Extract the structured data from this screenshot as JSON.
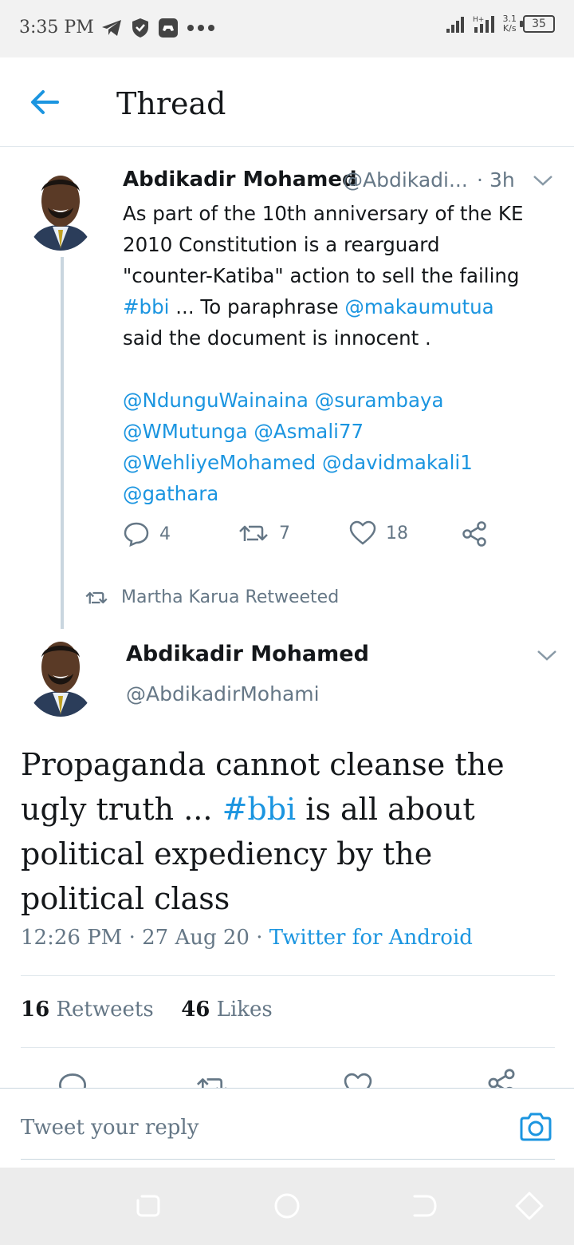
{
  "status_bar": {
    "time": "3:35 PM",
    "speed_value": "3.1",
    "speed_unit": "K/s",
    "battery": "35"
  },
  "header": {
    "title": "Thread"
  },
  "tweet1": {
    "name": "Abdikadir Mohamed",
    "handle": "@Abdikadi...",
    "dot": "·",
    "time": "3h",
    "line1": "As part of the 10th anniversary of the KE",
    "line2": "2010 Constitution is a rearguard",
    "line3": "\"counter-Katiba\" action  to sell the failing",
    "hashtag": "#bbi",
    "line4_mid": " ... To paraphrase ",
    "mention_main": "@makaumutua",
    "line5": "said the document is innocent .",
    "mentions": [
      "@NdunguWainaina",
      "@surambaya",
      "@WMutunga",
      "@Asmali77",
      "@WehliyeMohamed",
      "@davidmakali1",
      "@gathara"
    ],
    "reply_count": "4",
    "retweet_count": "7",
    "like_count": "18"
  },
  "retweeted_by": "Martha Karua Retweeted",
  "tweet2": {
    "name": "Abdikadir Mohamed",
    "handle": "@AbdikadirMohami",
    "text_before": "Propaganda cannot cleanse the ugly truth ... ",
    "hashtag": "#bbi",
    "text_after": " is all about political expediency by the political class",
    "timestamp": "12:26 PM · 27 Aug 20 · ",
    "source": "Twitter for Android",
    "retweets_count": "16",
    "retweets_label": "Retweets",
    "likes_count": "46",
    "likes_label": "Likes"
  },
  "reply": {
    "placeholder": "Tweet your reply"
  },
  "colors": {
    "accent": "#1b95e0",
    "muted": "#657786",
    "text": "#14171a"
  }
}
